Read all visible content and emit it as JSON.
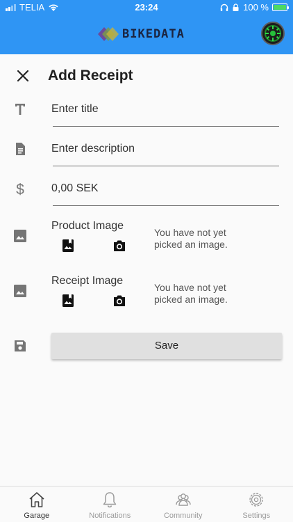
{
  "status_bar": {
    "carrier": "TELIA",
    "time": "23:24",
    "battery": "100 %"
  },
  "app_bar": {
    "logo_text": "BIKEDATA"
  },
  "page": {
    "title": "Add Receipt"
  },
  "form": {
    "title_placeholder": "Enter title",
    "description_placeholder": "Enter description",
    "amount_value": "0,00 SEK",
    "product_image": {
      "label": "Product Image",
      "empty_message": "You have not yet picked an image."
    },
    "receipt_image": {
      "label": "Receipt Image",
      "empty_message": "You have not yet picked an image."
    },
    "save_label": "Save"
  },
  "bottom_nav": {
    "items": [
      {
        "label": "Garage",
        "icon": "home-icon",
        "active": true
      },
      {
        "label": "Notifications",
        "icon": "bell-icon",
        "active": false
      },
      {
        "label": "Community",
        "icon": "people-icon",
        "active": false
      },
      {
        "label": "Settings",
        "icon": "gear-icon",
        "active": false
      }
    ]
  },
  "colors": {
    "app_bar": "#2f95f4",
    "background": "#fafafa",
    "button": "#e0e0e0",
    "inactive_nav": "#9a9a9a"
  }
}
